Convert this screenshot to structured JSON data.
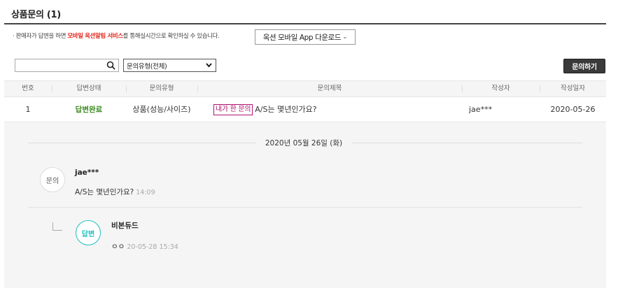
{
  "section": {
    "title": "상품문의 (1)"
  },
  "notice": {
    "bullet": "·",
    "pre": "판매자가 답변을 하면 ",
    "highlight": "모바일 옥션알림 서비스",
    "post": "를 통해실시간으로 확인하실 수 있습니다."
  },
  "app_download": {
    "label": "옥션 모바일 App 다운로드",
    "chevron": "⌄"
  },
  "search": {
    "value": "",
    "placeholder": ""
  },
  "filter": {
    "selected": "문의유형(전체)"
  },
  "ask_button": {
    "label": "문의하기"
  },
  "table": {
    "headers": {
      "no": "번호",
      "status": "답변상태",
      "type": "문의유형",
      "subject": "문의제목",
      "author": "작성자",
      "date": "작성일자"
    },
    "rows": [
      {
        "no": "1",
        "status": "답변완료",
        "type": "상품(성능/사이즈)",
        "badge": "내가 한 문의",
        "subject": "A/S는 몇년인가요?",
        "author": "jae***",
        "date": "2020-05-26"
      }
    ]
  },
  "detail": {
    "date": "2020년 05월 26일 (화)",
    "question": {
      "label": "문의",
      "author": "jae***",
      "text": "A/S는 몇년인가요?",
      "time": "14:09"
    },
    "answer": {
      "label": "답변",
      "author": "비본듀드",
      "text": "ㅇㅇ",
      "time": "20-05-28 15:34"
    }
  },
  "colors": {
    "highlight_red": "#e2231a",
    "status_green": "#3a8a1e",
    "badge_magenta": "#b0146e",
    "answer_teal": "#1fbfbf",
    "button_dark": "#3a3a3a"
  },
  "icons": [
    "search-icon",
    "chevron-down-icon",
    "reply-arrow-icon"
  ]
}
